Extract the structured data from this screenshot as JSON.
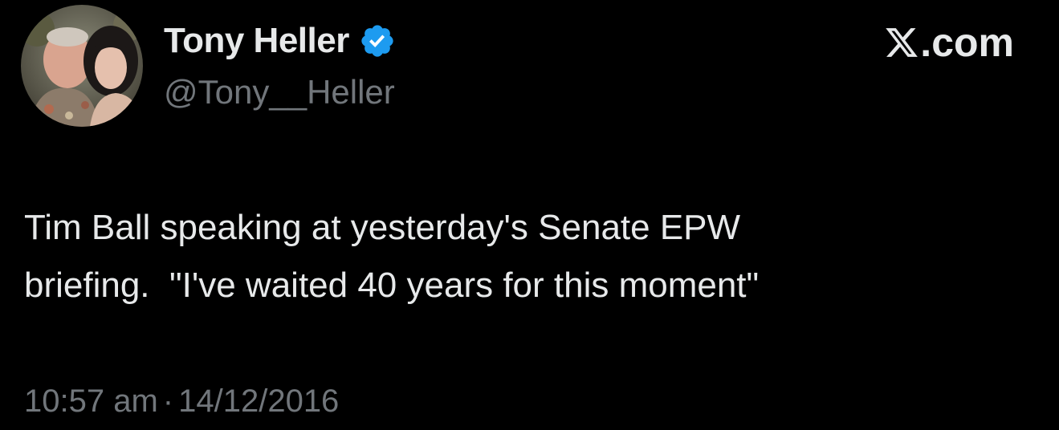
{
  "author": {
    "display_name": "Tony Heller",
    "handle": "@Tony__Heller",
    "verified": true,
    "avatar_icon": "profile-photo",
    "verified_icon": "verified-badge-icon"
  },
  "brand": {
    "icon": "x-logo-icon",
    "label": ".com"
  },
  "tweet": {
    "lines": [
      "Tim Ball speaking at yesterday's Senate EPW",
      "briefing.  \"I've waited 40 years for this moment\""
    ]
  },
  "meta": {
    "time": "10:57 am",
    "separator": "·",
    "date": "14/12/2016"
  },
  "colors": {
    "background": "#000000",
    "primary_text": "#e7e9ea",
    "secondary_text": "#71767b",
    "verified_blue": "#1d9bf0"
  }
}
